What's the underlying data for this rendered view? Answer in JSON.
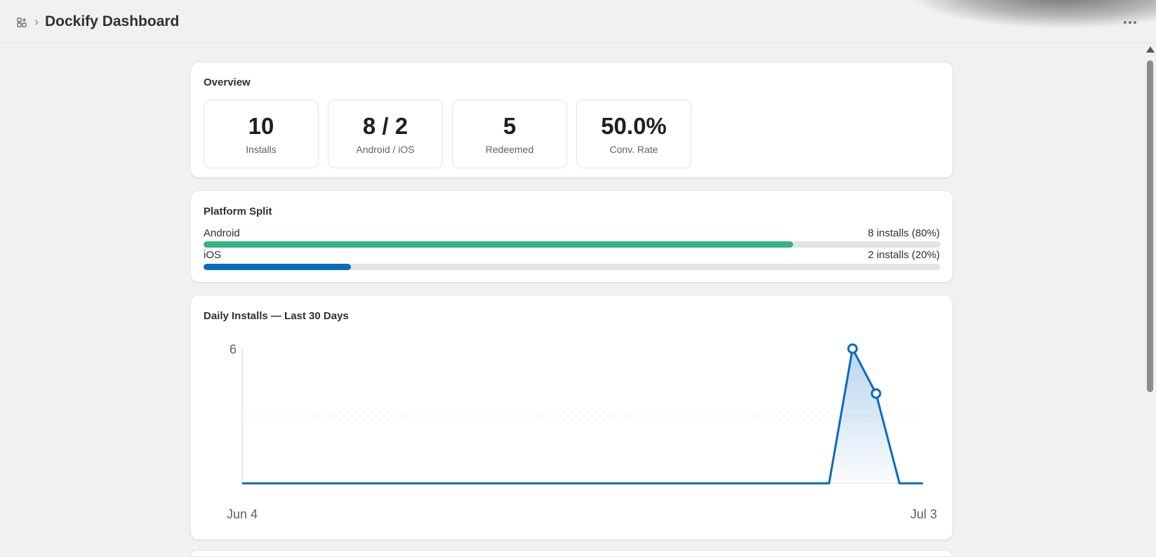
{
  "header": {
    "title": "Dockify Dashboard",
    "breadcrumb_separator": "›",
    "app_icon": "apps-icon",
    "more_icon": "more-horizontal-icon"
  },
  "overview": {
    "title": "Overview",
    "stats": [
      {
        "value": "10",
        "label": "Installs"
      },
      {
        "value": "8 / 2",
        "label": "Android / iOS"
      },
      {
        "value": "5",
        "label": "Redeemed"
      },
      {
        "value": "50.0%",
        "label": "Conv. Rate"
      }
    ]
  },
  "platform_split": {
    "title": "Platform Split",
    "rows": [
      {
        "name": "Android",
        "count_text": "8 installs (80%)",
        "fraction": 0.8,
        "color": "#36b37e"
      },
      {
        "name": "iOS",
        "count_text": "2 installs (20%)",
        "fraction": 0.2,
        "color": "#0a6bbd"
      }
    ]
  },
  "daily_installs": {
    "title": "Daily Installs — Last 30 Days"
  },
  "colors": {
    "accent": "#0a6bbd",
    "android": "#36b37e",
    "ios": "#0a6bbd"
  },
  "chart_data": {
    "type": "area",
    "title": "Daily Installs — Last 30 Days",
    "xlabel": "",
    "ylabel": "",
    "x_start_label": "Jun 4",
    "x_end_label": "Jul 3",
    "x_tick_labels": [
      "Jun 4",
      "Jul 3"
    ],
    "y_tick_labels": [
      "6"
    ],
    "ylim": [
      0,
      6
    ],
    "grid": true,
    "legend": "none",
    "series": [
      {
        "values": [
          0,
          0,
          0,
          0,
          0,
          0,
          0,
          0,
          0,
          0,
          0,
          0,
          0,
          0,
          0,
          0,
          0,
          0,
          0,
          0,
          0,
          0,
          0,
          0,
          0,
          0,
          6,
          4,
          0,
          0
        ],
        "color": "#0a6bbd"
      }
    ]
  }
}
